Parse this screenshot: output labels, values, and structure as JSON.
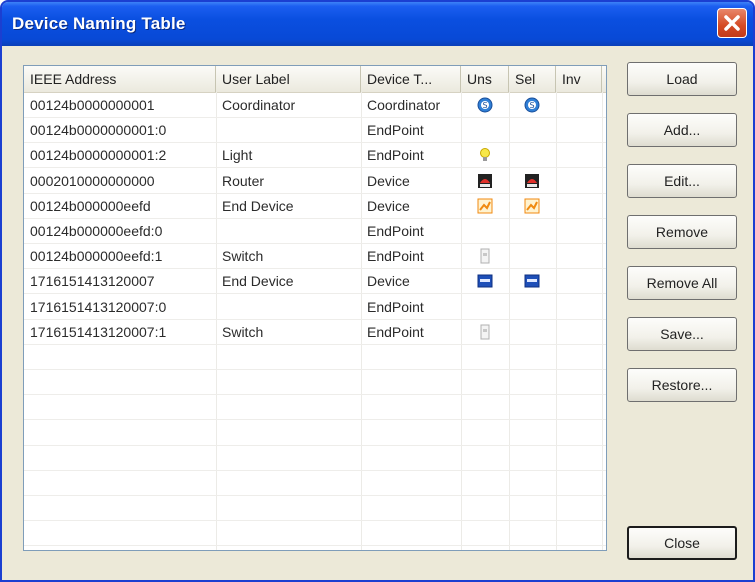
{
  "window": {
    "title": "Device Naming Table"
  },
  "table": {
    "columns": [
      "IEEE Address",
      "User Label",
      "Device T...",
      "Uns",
      "Sel",
      "Inv"
    ],
    "rows": [
      {
        "address": "00124b0000000001",
        "label": "Coordinator",
        "type": "Coordinator",
        "uns_icon": "coordinator-icon",
        "sel_icon": "coordinator-icon"
      },
      {
        "address": "00124b0000000001:0",
        "label": "",
        "type": "EndPoint",
        "uns_icon": "",
        "sel_icon": ""
      },
      {
        "address": "00124b0000000001:2",
        "label": "Light",
        "type": "EndPoint",
        "uns_icon": "light-bulb-icon",
        "sel_icon": ""
      },
      {
        "address": "0002010000000000",
        "label": "Router",
        "type": "Device",
        "uns_icon": "router-icon",
        "sel_icon": "router-icon"
      },
      {
        "address": "00124b000000eefd",
        "label": "End Device",
        "type": "Device",
        "uns_icon": "end-device-icon",
        "sel_icon": "end-device-icon"
      },
      {
        "address": "00124b000000eefd:0",
        "label": "",
        "type": "EndPoint",
        "uns_icon": "",
        "sel_icon": ""
      },
      {
        "address": "00124b000000eefd:1",
        "label": "Switch",
        "type": "EndPoint",
        "uns_icon": "switch-icon",
        "sel_icon": ""
      },
      {
        "address": "1716151413120007",
        "label": "End Device",
        "type": "Device",
        "uns_icon": "device-card-icon",
        "sel_icon": "device-card-icon"
      },
      {
        "address": "1716151413120007:0",
        "label": "",
        "type": "EndPoint",
        "uns_icon": "",
        "sel_icon": ""
      },
      {
        "address": "1716151413120007:1",
        "label": "Switch",
        "type": "EndPoint",
        "uns_icon": "switch-icon",
        "sel_icon": ""
      }
    ]
  },
  "buttons": {
    "load": "Load",
    "add": "Add...",
    "edit": "Edit...",
    "remove": "Remove",
    "remove_all": "Remove All",
    "save": "Save...",
    "restore": "Restore...",
    "close": "Close"
  },
  "colors": {
    "title_bar": "#0849d6",
    "window_bg": "#ece9d8",
    "list_border": "#7f9db9"
  }
}
